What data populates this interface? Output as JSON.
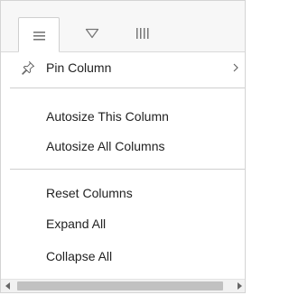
{
  "tabs": [
    {
      "icon": "menu-icon",
      "active": true
    },
    {
      "icon": "filter-icon",
      "active": false
    },
    {
      "icon": "columns-icon",
      "active": false
    }
  ],
  "menu": {
    "pin_column": {
      "label": "Pin Column",
      "icon": "pin-icon",
      "submenu_icon": "chevron-right-icon"
    },
    "autosize_this": {
      "label": "Autosize This Column"
    },
    "autosize_all": {
      "label": "Autosize All Columns"
    },
    "reset_columns": {
      "label": "Reset Columns"
    },
    "expand_all": {
      "label": "Expand All"
    },
    "collapse_all": {
      "label": "Collapse All"
    }
  },
  "colors": {
    "border": "#d4d4d4",
    "header_bg": "#f7f7f7",
    "icon": "#7a7a7a",
    "scrollbar_thumb": "#c1c1c1"
  }
}
